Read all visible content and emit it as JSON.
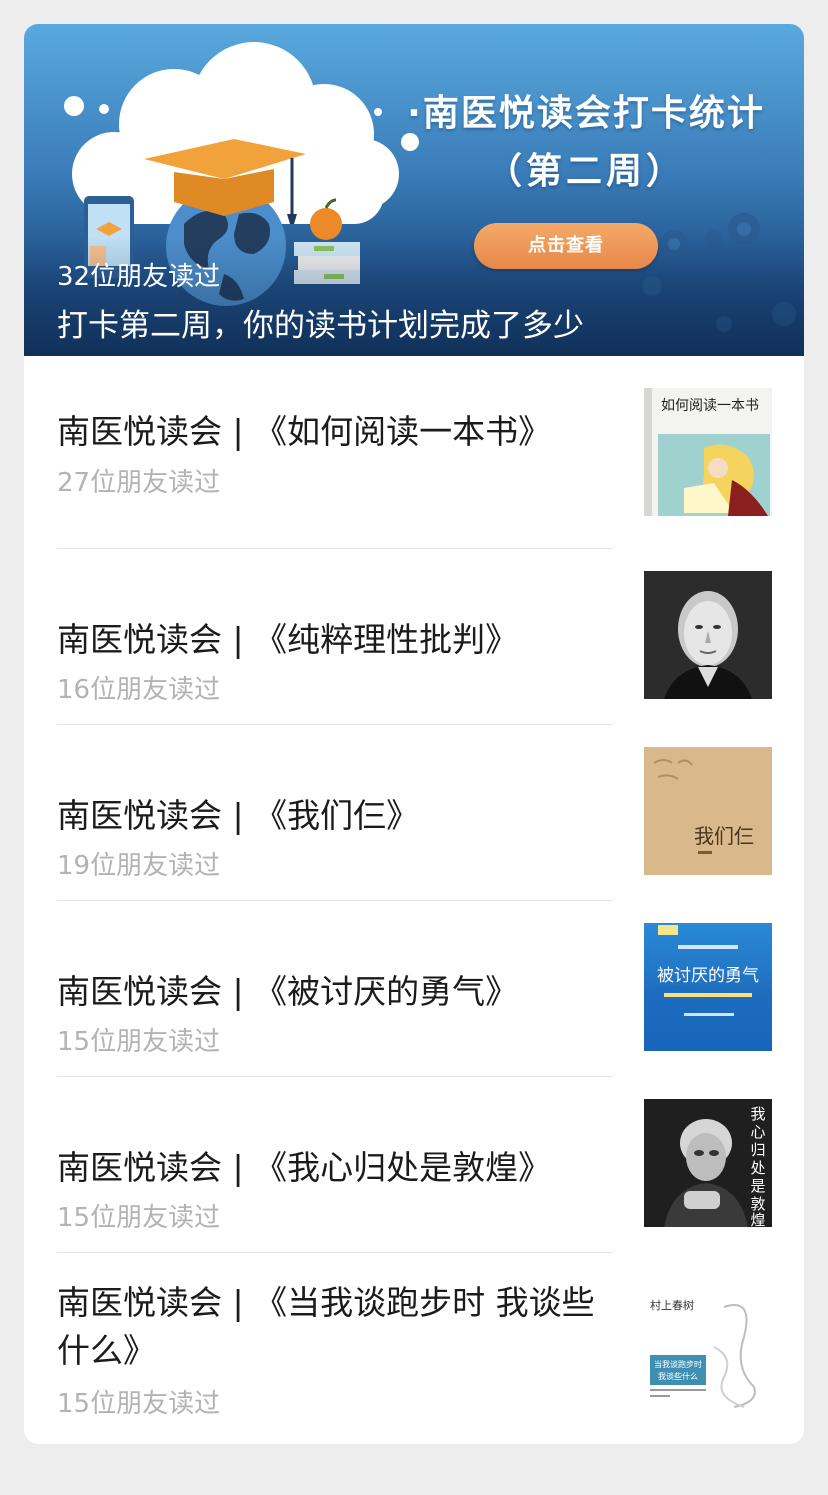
{
  "banner": {
    "title_line1": "·南医悦读会打卡统计",
    "title_line2": "（第二周）",
    "button_label": "点击查看",
    "read_count": "32位朋友读过",
    "description": "打卡第二周，你的读书计划完成了多少"
  },
  "articles": [
    {
      "title": "南医悦读会 | 《如何阅读一本书》",
      "read_count": "27位朋友读过",
      "cover_text": "如何阅读一本书",
      "cover_icon": "book-cover-how-to-read-icon"
    },
    {
      "title": "南医悦读会 | 《纯粹理性批判》",
      "read_count": "16位朋友读过",
      "cover_icon": "kant-portrait-icon"
    },
    {
      "title": "南医悦读会 | 《我们仨》",
      "read_count": "19位朋友读过",
      "cover_text": "我们仨",
      "cover_icon": "book-cover-we-three-icon"
    },
    {
      "title": "南医悦读会 | 《被讨厌的勇气》",
      "read_count": "15位朋友读过",
      "cover_text": "被讨厌的勇气",
      "cover_icon": "book-cover-courage-icon"
    },
    {
      "title": "南医悦读会 | 《我心归处是敦煌》",
      "read_count": "15位朋友读过",
      "cover_text": "我心归处是敦煌",
      "cover_icon": "book-cover-dunhuang-icon"
    },
    {
      "title": "南医悦读会 | 《当我谈跑步时 我谈些什么》",
      "read_count": "15位朋友读过",
      "cover_author": "村上春树",
      "cover_text": "当我谈跑步时 我谈些什么",
      "cover_icon": "book-cover-running-icon"
    }
  ],
  "colors": {
    "background": "#ededed",
    "card": "#ffffff",
    "title_text": "#1b1b1b",
    "meta_text": "#b3b3b3",
    "button_orange": "#e7884a"
  }
}
